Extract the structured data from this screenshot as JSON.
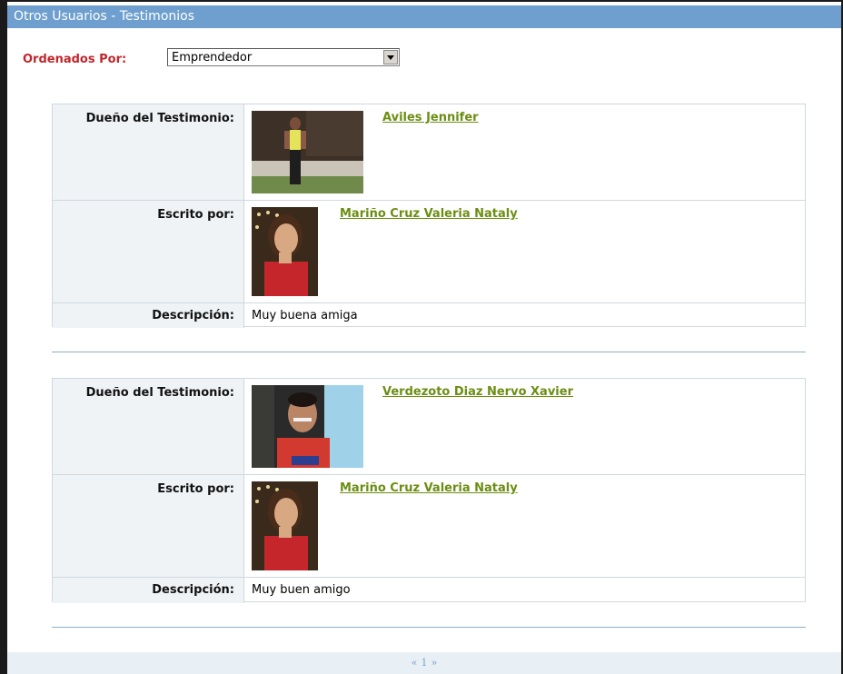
{
  "title": "Otros Usuarios - Testimonios",
  "sort": {
    "label": "Ordenados Por:",
    "selected": "Emprendedor"
  },
  "labels": {
    "owner": "Dueño del Testimonio:",
    "writer": "Escrito por:",
    "description": "Descripción:"
  },
  "testimonials": [
    {
      "owner_name": "Aviles Jennifer",
      "writer_name": "Mariño Cruz Valeria Nataly",
      "description": "Muy buena amiga"
    },
    {
      "owner_name": "Verdezoto Diaz Nervo Xavier",
      "writer_name": "Mariño Cruz Valeria Nataly",
      "description": "Muy buen amigo"
    }
  ],
  "pager": {
    "prev": "«",
    "page": "1",
    "next": "»"
  },
  "icons": {
    "select_arrow": "chevron-down-icon"
  }
}
